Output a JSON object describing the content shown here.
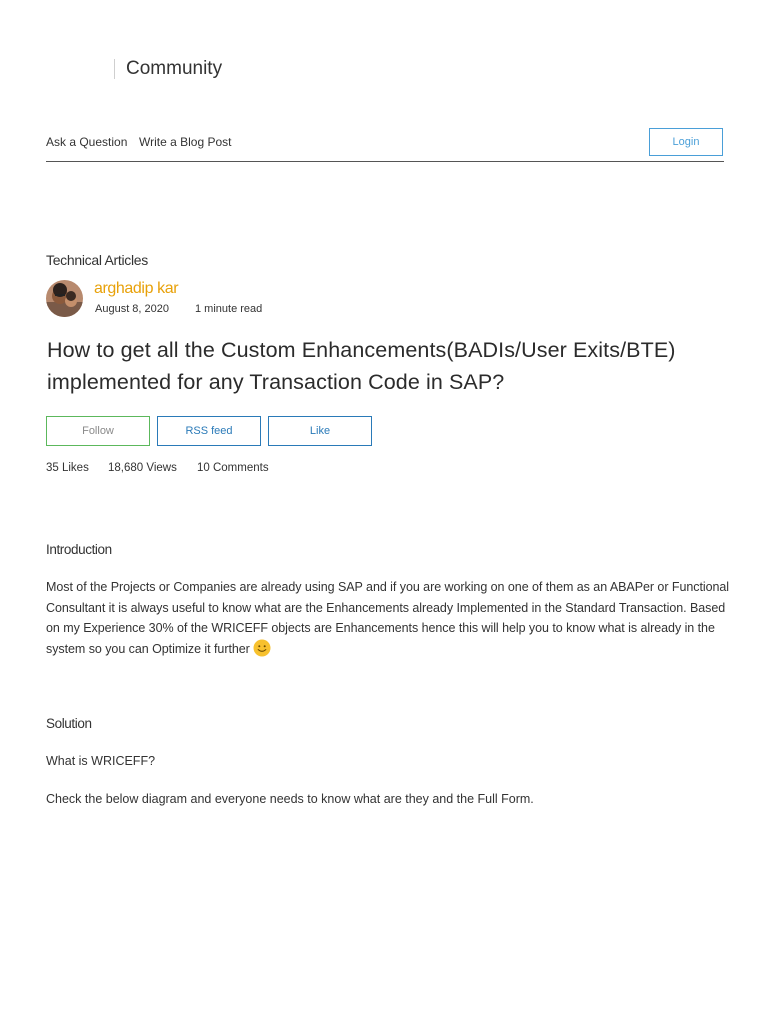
{
  "header": {
    "brand": "Community",
    "nav": {
      "ask_question": "Ask a Question",
      "write_blog_post": "Write a Blog Post"
    },
    "login_label": "Login"
  },
  "article": {
    "category": "Technical Articles",
    "author": {
      "name": "arghadip kar",
      "avatar_icon": "author-photo"
    },
    "date": "August 8, 2020",
    "read_time": "1 minute read",
    "title": "How to get all the Custom Enhancements(BADIs/User Exits/BTE) implemented for any Transaction Code in SAP?",
    "actions": {
      "follow": "Follow",
      "rss_feed": "RSS feed",
      "like": "Like"
    },
    "stats": {
      "likes": "35 Likes",
      "views": "18,680 Views",
      "comments": "10 Comments"
    },
    "sections": {
      "introduction_heading": "Introduction",
      "introduction_text": "Most of the Projects or Companies are already using SAP and if you are working on one of them as an ABAPer or Functional Consultant it is always useful to know what are the Enhancements already Implemented in the Standard Transaction. Based on my Experience 30% of the WRICEFF objects are Enhancements hence this will help you to know what is already in the system so you can Optimize it further",
      "introduction_emoji": "smile-icon",
      "solution_heading": "Solution",
      "wriceff_heading": "What is WRICEFF?",
      "wriceff_text": "Check the below diagram and everyone needs to know what are they and the Full Form."
    }
  },
  "colors": {
    "author_link": "#e8a10a",
    "primary_blue": "#2a7ab8",
    "login_blue": "#4a9fd8",
    "follow_green": "#5cb85c"
  }
}
